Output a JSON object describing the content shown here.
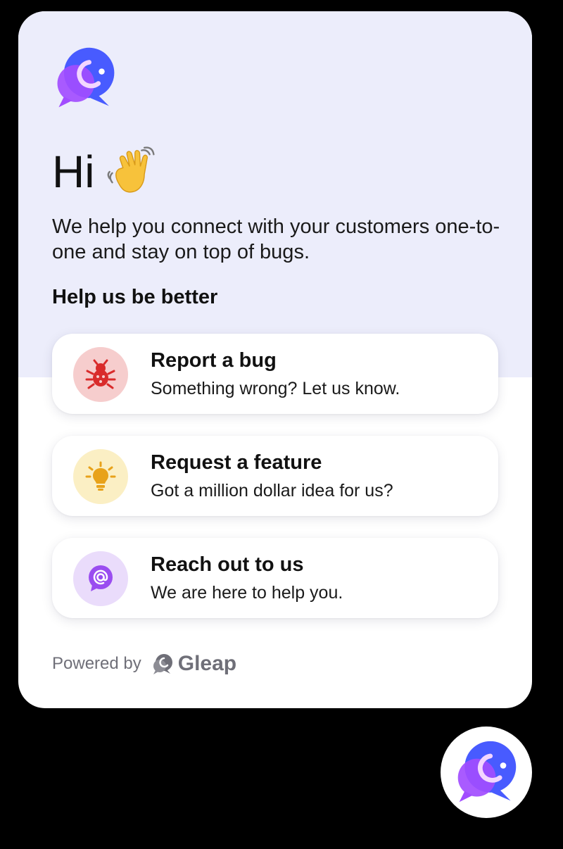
{
  "widget": {
    "greeting": "Hi",
    "greeting_emoji": "waving-hand-icon",
    "intro": "We help you connect with your customers one-to-one and stay on top of bugs.",
    "section_title": "Help us be better"
  },
  "cards": [
    {
      "title": "Report a bug",
      "subtitle": "Something wrong? Let us know.",
      "icon": "bug-icon",
      "icon_bg": "#f6cdcd",
      "icon_color": "#d92b2b"
    },
    {
      "title": "Request a feature",
      "subtitle": "Got a million dollar idea for us?",
      "icon": "lightbulb-icon",
      "icon_bg": "#fbefc4",
      "icon_color": "#e8a21a"
    },
    {
      "title": "Reach out to us",
      "subtitle": "We are here to help you.",
      "icon": "at-chat-icon",
      "icon_bg": "#eadcfb",
      "icon_color": "#9a4df0"
    }
  ],
  "footer": {
    "powered_by": "Powered by",
    "brand": "Gleap"
  },
  "colors": {
    "header_bg": "#ecedfb",
    "brand_blue": "#485bff",
    "brand_purple": "#a24dff",
    "muted_text": "#6f6f78"
  }
}
